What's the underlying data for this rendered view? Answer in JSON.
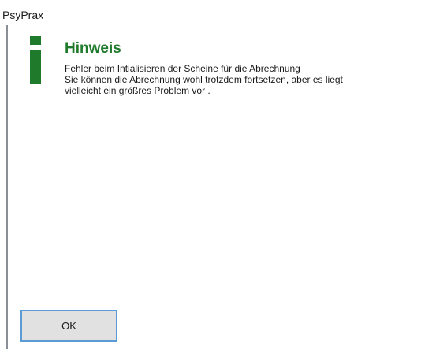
{
  "window": {
    "title": "PsyPrax"
  },
  "dialog": {
    "icon": "info-icon",
    "icon_color": "#1f7a2b",
    "heading": "Hinweis",
    "heading_color": "#1f7a2b",
    "message_lines": [
      "Fehler beim Intialisieren der Scheine für die Abrechnung",
      "Sie können die Abrechnung wohl trotzdem fortsetzen, aber es liegt",
      "vielleicht ein größres Problem vor ."
    ]
  },
  "buttons": {
    "ok_label": "OK",
    "focus_border_color": "#5b9bd5"
  }
}
